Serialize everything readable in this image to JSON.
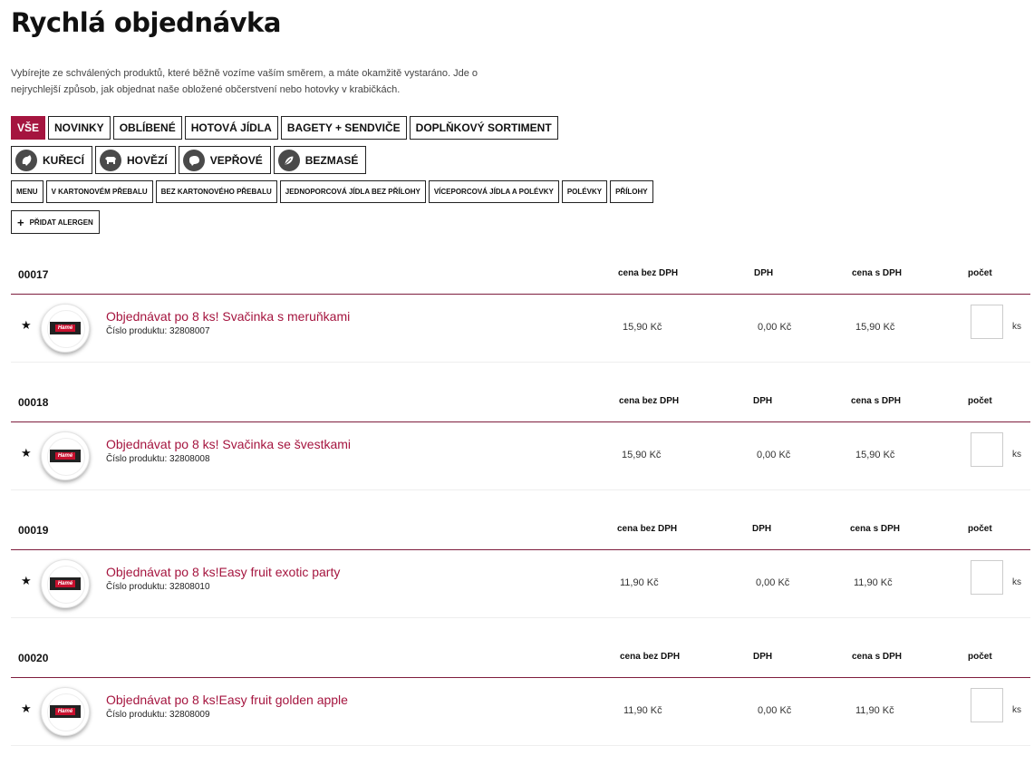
{
  "page": {
    "title": "Rychlá objednávka",
    "intro": "Vybírejte ze schválených produktů, které běžně vozíme vaším směrem, a máte okamžitě vystaráno. Jde o nejrychlejší způsob, jak objednat naše obložené občerstvení nebo hotovky v krabičkách."
  },
  "filters": {
    "categories": [
      "VŠE",
      "NOVINKY",
      "OBLÍBENÉ",
      "HOTOVÁ JÍDLA",
      "BAGETY + SENDVIČE",
      "DOPLŇKOVÝ SORTIMENT"
    ],
    "meats": [
      {
        "label": "KUŘECÍ",
        "icon": "chicken-icon"
      },
      {
        "label": "HOVĚZÍ",
        "icon": "cow-icon"
      },
      {
        "label": "VEPŘOVÉ",
        "icon": "pig-icon"
      },
      {
        "label": "BEZMASÉ",
        "icon": "leaf-icon"
      }
    ],
    "subcategories": [
      "MENU",
      "V KARTONOVÉM PŘEBALU",
      "BEZ KARTONOVÉHO PŘEBALU",
      "JEDNOPORCOVÁ JÍDLA BEZ PŘÍLOHY",
      "VÍCEPORCOVÁ JÍDLA A POLÉVKY",
      "POLÉVKY",
      "PŘÍLOHY"
    ],
    "allergen_button": "PŘIDAT ALERGEN"
  },
  "table_headers": {
    "price_no_vat": "cena bez DPH",
    "vat": "DPH",
    "price_with_vat": "cena s DPH",
    "count": "počet"
  },
  "products": [
    {
      "code": "00017",
      "name": "Objednávat po 8 ks! Svačinka s meruňkami",
      "number_label": "Číslo produktu: 32808007",
      "price_no_vat": "15,90 Kč",
      "vat": "0,00 Kč",
      "price_with_vat": "15,90 Kč",
      "unit": "ks",
      "qty": ""
    },
    {
      "code": "00018",
      "name": "Objednávat po 8 ks! Svačinka se švestkami",
      "number_label": "Číslo produktu: 32808008",
      "price_no_vat": "15,90 Kč",
      "vat": "0,00 Kč",
      "price_with_vat": "15,90 Kč",
      "unit": "ks",
      "qty": ""
    },
    {
      "code": "00019",
      "name": "Objednávat po 8 ks!Easy fruit exotic party",
      "number_label": "Číslo produktu: 32808010",
      "price_no_vat": "11,90 Kč",
      "vat": "0,00 Kč",
      "price_with_vat": "11,90 Kč",
      "unit": "ks",
      "qty": ""
    },
    {
      "code": "00020",
      "name": "Objednávat po 8 ks!Easy fruit golden apple",
      "number_label": "Číslo produktu: 32808009",
      "price_no_vat": "11,90 Kč",
      "vat": "0,00 Kč",
      "price_with_vat": "11,90 Kč",
      "unit": "ks",
      "qty": ""
    }
  ],
  "thumbnail_label": "Hamé",
  "colors": {
    "accent": "#a5153f",
    "divider": "#7e1d3d"
  }
}
